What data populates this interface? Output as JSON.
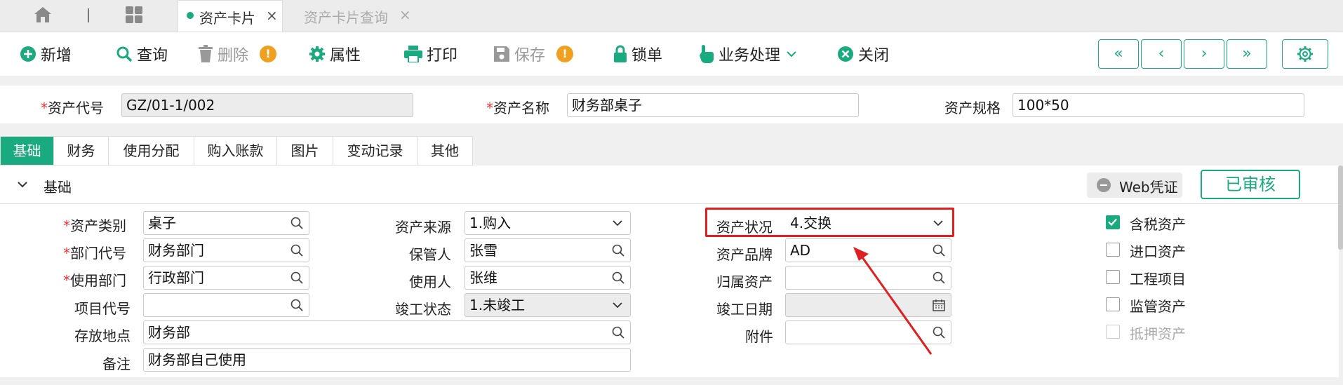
{
  "tabs": [
    {
      "label": "资产卡片",
      "close": "×",
      "active": true
    },
    {
      "label": "资产卡片查询",
      "close": "×",
      "active": false
    }
  ],
  "toolbar": {
    "add": "新增",
    "query": "查询",
    "delete": "删除",
    "props": "属性",
    "print": "打印",
    "save": "保存",
    "lock": "锁单",
    "business": "业务处理",
    "close": "关闭",
    "warn": "!",
    "nav": [
      "«",
      "‹",
      "›",
      "»"
    ]
  },
  "header": {
    "asset_code_label": "资产代号",
    "asset_code": "GZ/01-1/002",
    "asset_name_label": "资产名称",
    "asset_name": "财务部桌子",
    "asset_spec_label": "资产规格",
    "asset_spec": "100*50"
  },
  "subtabs": [
    "基础",
    "财务",
    "使用分配",
    "购入账款",
    "图片",
    "变动记录",
    "其他"
  ],
  "section": {
    "title": "基础",
    "toggle": "∨",
    "web_voucher": "Web凭证",
    "approved": "已审核"
  },
  "fields": {
    "category": {
      "label": "资产类别",
      "value": "桌子"
    },
    "dept_code": {
      "label": "部门代号",
      "value": "财务部门"
    },
    "use_dept": {
      "label": "使用部门",
      "value": "行政部门"
    },
    "project_code": {
      "label": "项目代号",
      "value": ""
    },
    "location": {
      "label": "存放地点",
      "value": "财务部"
    },
    "remark": {
      "label": "备注",
      "value": "财务部自己使用"
    },
    "source": {
      "label": "资产来源",
      "value": "1.购入"
    },
    "keeper": {
      "label": "保管人",
      "value": "张雪"
    },
    "user": {
      "label": "使用人",
      "value": "张维"
    },
    "complete_status": {
      "label": "竣工状态",
      "value": "1.未竣工"
    },
    "asset_status": {
      "label": "资产状况",
      "value": "4.交换"
    },
    "brand": {
      "label": "资产品牌",
      "value": "AD"
    },
    "belong_asset": {
      "label": "归属资产",
      "value": ""
    },
    "complete_date": {
      "label": "竣工日期",
      "value": ""
    },
    "attachment": {
      "label": "附件",
      "value": ""
    }
  },
  "checkboxes": [
    {
      "label": "含税资产",
      "checked": true,
      "disabled": false
    },
    {
      "label": "进口资产",
      "checked": false,
      "disabled": false
    },
    {
      "label": "工程项目",
      "checked": false,
      "disabled": false
    },
    {
      "label": "监管资产",
      "checked": false,
      "disabled": false
    },
    {
      "label": "抵押资产",
      "checked": false,
      "disabled": true
    }
  ],
  "colors": {
    "accent": "#1aaa80",
    "highlight": "#e02020",
    "required": "#e33333",
    "warning": "#f0a020"
  }
}
